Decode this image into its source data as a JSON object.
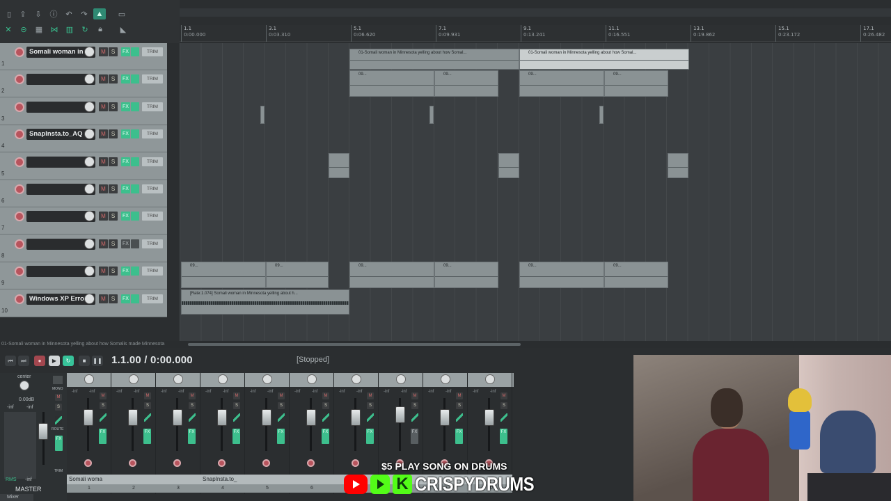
{
  "ruler": {
    "ticks": [
      {
        "bar": "1.1",
        "time": "0:00.000"
      },
      {
        "bar": "3.1",
        "time": "0:03.310"
      },
      {
        "bar": "5.1",
        "time": "0:06.620"
      },
      {
        "bar": "7.1",
        "time": "0:09.931"
      },
      {
        "bar": "9.1",
        "time": "0:13.241"
      },
      {
        "bar": "11.1",
        "time": "0:16.551"
      },
      {
        "bar": "13.1",
        "time": "0:19.862"
      },
      {
        "bar": "15.1",
        "time": "0:23.172"
      },
      {
        "bar": "17.1",
        "time": "0:26.482"
      }
    ]
  },
  "tracks": [
    {
      "num": "1",
      "name": "Somali woman in",
      "fx_on": true
    },
    {
      "num": "2",
      "name": "",
      "fx_on": true
    },
    {
      "num": "3",
      "name": "",
      "fx_on": true
    },
    {
      "num": "4",
      "name": "SnapInsta.to_AQ",
      "fx_on": true
    },
    {
      "num": "5",
      "name": "",
      "fx_on": true
    },
    {
      "num": "6",
      "name": "",
      "fx_on": true
    },
    {
      "num": "7",
      "name": "",
      "fx_on": true
    },
    {
      "num": "8",
      "name": "",
      "fx_on": false
    },
    {
      "num": "9",
      "name": "",
      "fx_on": true
    },
    {
      "num": "10",
      "name": "Windows XP Erro",
      "fx_on": true
    }
  ],
  "track_buttons": {
    "mute": "M",
    "solo": "S",
    "fx": "FX",
    "trim": "TRIM"
  },
  "items": {
    "item_1a": "01-Somali woman in Minnesota yelling about how Somal...",
    "item_1b": "01-Somali woman in Minnesota yelling about how Somal...",
    "item_10": "[Rate:1.074] Somali woman in Minnesota yelling about h...",
    "short_label": "09..."
  },
  "hscroll": {
    "text": "01-Somali woman in Minnesota yelling about how Somalis made Minnesota"
  },
  "transport": {
    "position": "1.1.00 / 0:00.000",
    "status": "[Stopped]"
  },
  "master": {
    "pan_label": "center",
    "volume": "0.00dB",
    "inf_left": "-inf",
    "inf_right": "-inf",
    "mono": "MONO",
    "route": "ROUTE",
    "trim": "TRIM",
    "rms": "RMS",
    "rms_val": "-inf",
    "name": "MASTER"
  },
  "mixer": {
    "strips": [
      {
        "num": "1",
        "name": "Somali woma",
        "inf": "-inf",
        "fx_on": true
      },
      {
        "num": "2",
        "name": "",
        "inf": "-inf",
        "fx_on": true
      },
      {
        "num": "3",
        "name": "",
        "inf": "-inf",
        "fx_on": true
      },
      {
        "num": "4",
        "name": "SnapInsta.to_",
        "inf": "-inf",
        "fx_on": true
      },
      {
        "num": "5",
        "name": "",
        "inf": "-inf",
        "fx_on": true
      },
      {
        "num": "6",
        "name": "",
        "inf": "-inf",
        "fx_on": true
      },
      {
        "num": "7",
        "name": "",
        "inf": "-inf",
        "fx_on": true
      },
      {
        "num": "8",
        "name": "",
        "inf": "-inf",
        "fx_on": false
      },
      {
        "num": "9",
        "name": "",
        "inf": "-inf",
        "fx_on": true
      },
      {
        "num": "10",
        "name": "",
        "inf": "-inf",
        "fx_on": true
      }
    ],
    "tab_label": "Mixer"
  },
  "promo": {
    "line1": "$5 PLAY SONG ON DRUMS",
    "brand": "CRISPYDRUMS",
    "kick_letter": "K"
  },
  "colors": {
    "accent": "#3dbf8d",
    "record": "#b8545d",
    "background": "#2b2e30"
  }
}
